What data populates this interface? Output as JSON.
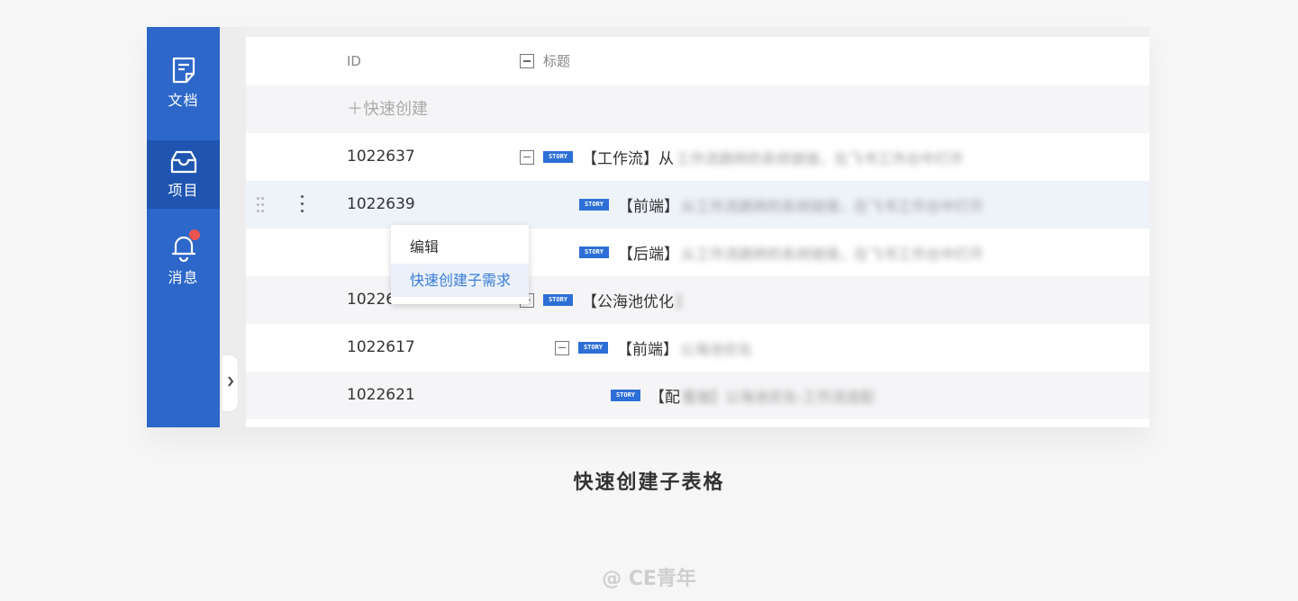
{
  "sidebar": {
    "items": [
      {
        "label": "文档",
        "icon": "document-icon"
      },
      {
        "label": "项目",
        "icon": "inbox-icon"
      },
      {
        "label": "消息",
        "icon": "bell-icon"
      }
    ],
    "active_index": 1,
    "notification_badge": true
  },
  "table": {
    "columns": {
      "id": "ID",
      "title": "标题"
    },
    "quick_create": "快速创建",
    "rows": [
      {
        "id": "1022637",
        "title": "【工作流】从",
        "blurred": "工作流跳转的系统链接，在飞书工作台中打开",
        "story": "STORY",
        "collapsible": true
      },
      {
        "id": "1022639",
        "title": "【前端】",
        "blurred": "从工作流跳转的系统链接，在飞书工作台中打开",
        "story": "STORY",
        "collapsible": false
      },
      {
        "id": "",
        "title": "【后端】",
        "blurred": "从工作流跳转的系统链接，在飞书工作台中打开",
        "story": "STORY",
        "collapsible": false
      },
      {
        "id": "1022608",
        "title": "【公海池优化",
        "blurred": "】",
        "story": "STORY",
        "collapsible": true
      },
      {
        "id": "1022617",
        "title": "【前端】",
        "blurred": "公海池优化",
        "story": "STORY",
        "collapsible": true
      },
      {
        "id": "1022621",
        "title": "【配",
        "blurred": "置端】公海池优化-工作流适配",
        "story": "STORY",
        "collapsible": false
      }
    ]
  },
  "context_menu": {
    "items": [
      "编辑",
      "快速创建子需求"
    ],
    "highlighted_index": 1
  },
  "caption": "快速创建子表格",
  "watermark": "@ CE青年",
  "colors": {
    "sidebar": "#2c67c9",
    "sidebar_active": "#1f55b0",
    "accent": "#3a7bd5",
    "badge": "#ef5350",
    "story_tag": "#2d6fd6"
  }
}
